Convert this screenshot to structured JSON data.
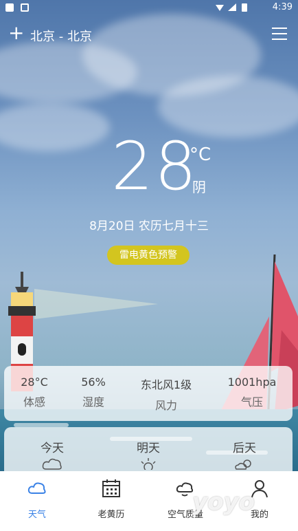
{
  "status_bar": {
    "time": "4:39"
  },
  "header": {
    "city": "北京 - 北京"
  },
  "weather": {
    "temperature": "28",
    "unit": "°C",
    "condition": "阴",
    "date": "8月20日 农历七月十三",
    "alert": "雷电黄色预警"
  },
  "stats": [
    {
      "value": "28°C",
      "label": "体感"
    },
    {
      "value": "56%",
      "label": "湿度"
    },
    {
      "value": "东北风1级",
      "label": "风力"
    },
    {
      "value": "1001hpa",
      "label": "气压"
    }
  ],
  "forecast": [
    {
      "day": "今天",
      "icon": "cloud-icon"
    },
    {
      "day": "明天",
      "icon": "sun-icon"
    },
    {
      "day": "后天",
      "icon": "partly-cloudy-icon"
    }
  ],
  "tabs": [
    {
      "label": "天气",
      "icon": "cloud-icon",
      "active": true
    },
    {
      "label": "老黄历",
      "icon": "calendar-icon",
      "active": false
    },
    {
      "label": "空气质量",
      "icon": "air-icon",
      "active": false
    },
    {
      "label": "我的",
      "icon": "person-icon",
      "active": false
    }
  ],
  "watermark": "yoyo",
  "colors": {
    "accent": "#3a82e6",
    "alert": "#d3c51f",
    "sky": "#6d92c0",
    "sail": "#e0546a"
  }
}
